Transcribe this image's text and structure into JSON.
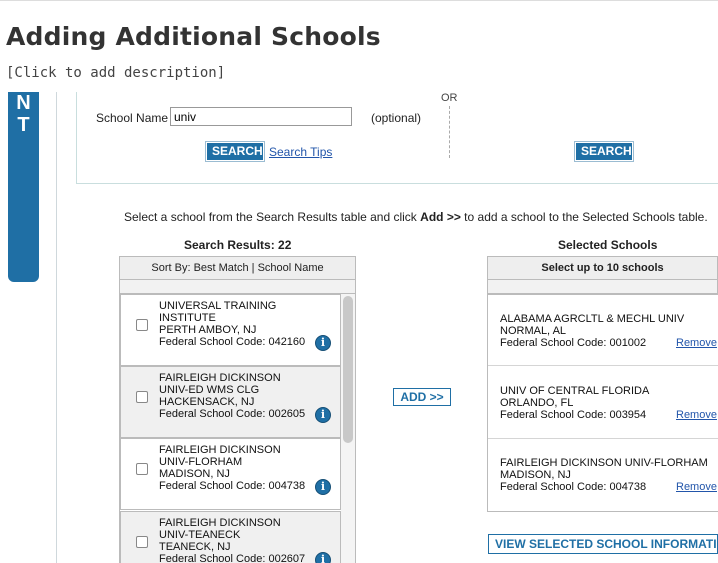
{
  "page": {
    "title": "Adding Additional Schools",
    "description": "[Click to add description]"
  },
  "side_tab": {
    "letters": [
      "N",
      "T"
    ]
  },
  "search": {
    "or_label": "OR",
    "school_name_label": "School Name",
    "school_name_value": "univ",
    "optional_label": "(optional)",
    "search_button_label": "SEARCH",
    "search_tips_label": "Search Tips",
    "search_button_2_label": "SEARCH"
  },
  "instructions": {
    "part1": "Select a school from the Search Results table and click ",
    "add_word": "Add >>",
    "part2": " to add a school to the Selected Schools table."
  },
  "results": {
    "heading": "Search Results: 22",
    "sort_label": "Sort By:",
    "sort_current": "Best Match |",
    "sort_link": "School Name",
    "items": [
      {
        "lines": [
          "UNIVERSAL TRAINING",
          "INSTITUTE",
          "PERTH AMBOY, NJ"
        ],
        "code": "Federal School Code: 042160"
      },
      {
        "lines": [
          "FAIRLEIGH DICKINSON",
          "UNIV-ED WMS CLG",
          "HACKENSACK, NJ"
        ],
        "code": "Federal School Code: 002605"
      },
      {
        "lines": [
          "FAIRLEIGH DICKINSON",
          "UNIV-FLORHAM",
          "MADISON, NJ"
        ],
        "code": "Federal School Code: 004738"
      },
      {
        "lines": [
          "FAIRLEIGH DICKINSON",
          "UNIV-TEANECK",
          "TEANECK, NJ"
        ],
        "code": "Federal School Code: 002607"
      }
    ]
  },
  "add_button_label": "ADD >>",
  "selected": {
    "heading": "Selected Schools",
    "subheading": "Select up to 10 schools",
    "remove_label": "Remove",
    "items": [
      {
        "lines": [
          "ALABAMA AGRCLTL & MECHL UNIV",
          "NORMAL, AL"
        ],
        "code": "Federal School Code: 001002"
      },
      {
        "lines": [
          "UNIV OF CENTRAL FLORIDA",
          "ORLANDO, FL"
        ],
        "code": "Federal School Code: 003954"
      },
      {
        "lines": [
          "FAIRLEIGH DICKINSON UNIV-FLORHAM",
          "MADISON, NJ"
        ],
        "code": "Federal School Code: 004738"
      }
    ]
  },
  "view_button_label": "VIEW SELECTED SCHOOL INFORMATION",
  "colors": {
    "accent": "#1f6fa5",
    "link": "#2255aa"
  },
  "icons": {
    "info": "info-icon"
  }
}
